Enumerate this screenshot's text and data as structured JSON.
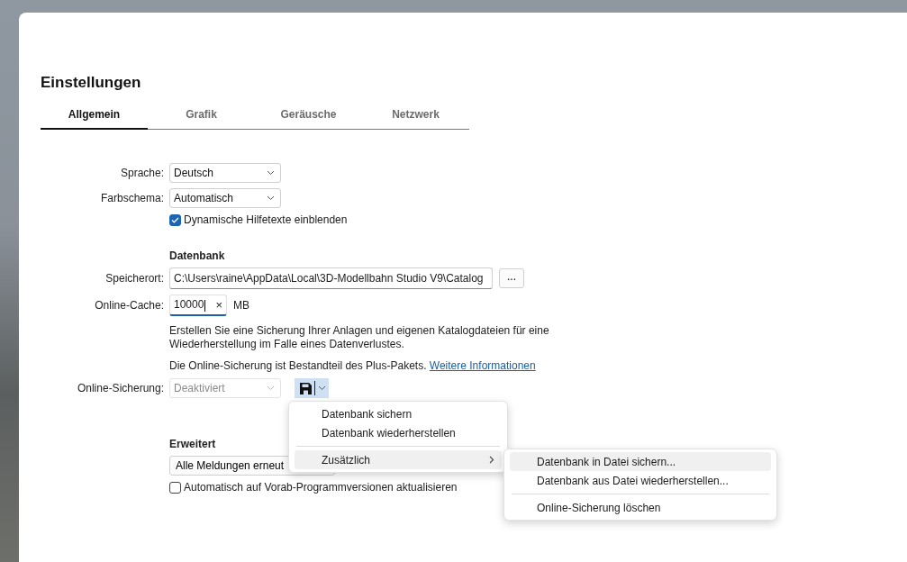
{
  "window": {
    "title": "Einstellungen"
  },
  "tabs": [
    {
      "label": "Allgemein",
      "selected": true
    },
    {
      "label": "Grafik",
      "selected": false
    },
    {
      "label": "Geräusche",
      "selected": false
    },
    {
      "label": "Netzwerk",
      "selected": false
    }
  ],
  "sections": [
    {
      "rows": [
        {
          "kind": "select",
          "label": "Sprache:",
          "value": "Deutsch",
          "disabled": false
        },
        {
          "kind": "select",
          "label": "Farbschema:",
          "value": "Automatisch",
          "disabled": false
        },
        {
          "kind": "checkbox",
          "label": "Dynamische Hilfetexte einblenden",
          "checked": true
        }
      ]
    },
    {
      "heading": "Datenbank",
      "rows": [
        {
          "kind": "path",
          "label": "Speicherort:",
          "value": "C:\\Users\\raine\\AppData\\Local\\3D-Modellbahn Studio V9\\Catalog",
          "button": "..."
        },
        {
          "kind": "number",
          "label": "Online-Cache:",
          "value": "10000",
          "clear": "×",
          "unit": "MB"
        },
        {
          "kind": "text",
          "text": "Erstellen Sie eine Sicherung Ihrer Anlagen und eigenen Katalogdateien für eine\nWiederherstellung im Falle eines Datenverlustes."
        },
        {
          "kind": "text",
          "text": "Die Online-Sicherung ist Bestandteil des Plus-Pakets.",
          "link": "Weitere Informationen"
        },
        {
          "kind": "backup",
          "label": "Online-Sicherung:",
          "value": "Deaktiviert",
          "disabled": true,
          "expanded": true
        }
      ]
    },
    {
      "heading": "Erweitert",
      "rows": [
        {
          "kind": "button",
          "label": "Alle Meldungen erneut"
        },
        {
          "kind": "checkbox",
          "label": "Automatisch auf Vorab-Programmversionen aktualisieren",
          "checked": false
        }
      ]
    }
  ],
  "menu": {
    "items": [
      {
        "kind": "item",
        "label": "Datenbank sichern",
        "selected": false
      },
      {
        "kind": "item",
        "label": "Datenbank wiederherstellen",
        "selected": false
      },
      {
        "kind": "separator"
      },
      {
        "kind": "submenu",
        "label": "Zusätzlich",
        "selected": true
      }
    ]
  },
  "submenu": {
    "items": [
      {
        "kind": "item",
        "label": "Datenbank in Datei sichern...",
        "selected": true
      },
      {
        "kind": "item",
        "label": "Datenbank aus Datei wiederherstellen...",
        "selected": false
      },
      {
        "kind": "separator"
      },
      {
        "kind": "item",
        "label": "Online-Sicherung löschen",
        "selected": false
      }
    ]
  }
}
